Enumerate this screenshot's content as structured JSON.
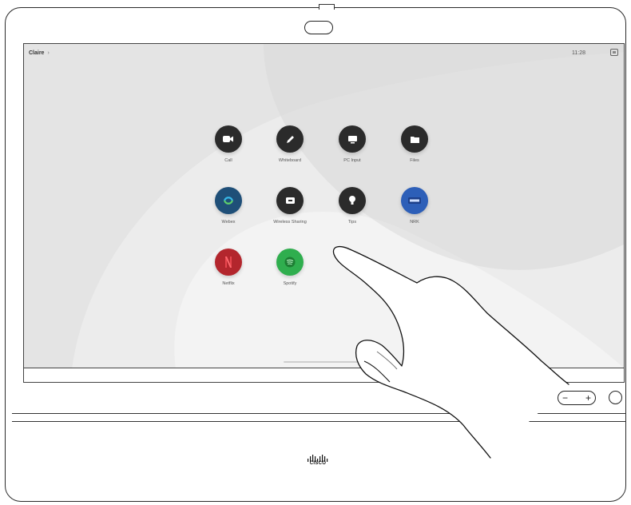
{
  "header": {
    "breadcrumb_label": "Claire",
    "breadcrumb_chevron": "›",
    "time": "11:28"
  },
  "apps": [
    {
      "label": "Call",
      "color": "#2b2b2b",
      "icon": "camera-icon"
    },
    {
      "label": "Whiteboard",
      "color": "#2b2b2b",
      "icon": "pencil-icon"
    },
    {
      "label": "PC Input",
      "color": "#2b2b2b",
      "icon": "monitor-icon"
    },
    {
      "label": "Files",
      "color": "#2b2b2b",
      "icon": "folder-icon"
    },
    {
      "label": "Webex",
      "color": "#1f4f78",
      "icon": "webex-icon"
    },
    {
      "label": "Wireless Sharing",
      "color": "#2b2b2b",
      "icon": "screen-share-icon"
    },
    {
      "label": "Tips",
      "color": "#2b2b2b",
      "icon": "lightbulb-icon"
    },
    {
      "label": "NRK",
      "color": "#2d5fb8",
      "icon": "nrk-icon"
    },
    {
      "label": "Netflix",
      "color": "#b3262d",
      "icon": "netflix-icon"
    },
    {
      "label": "Spotify",
      "color": "#2fae4e",
      "icon": "spotify-icon"
    }
  ],
  "controls": {
    "volume_minus": "−",
    "volume_plus": "+"
  },
  "brand": {
    "logo_text": "CISCO"
  },
  "colors": {
    "screen_background": "#e6e6e6",
    "dark_button": "#2b2b2b"
  }
}
